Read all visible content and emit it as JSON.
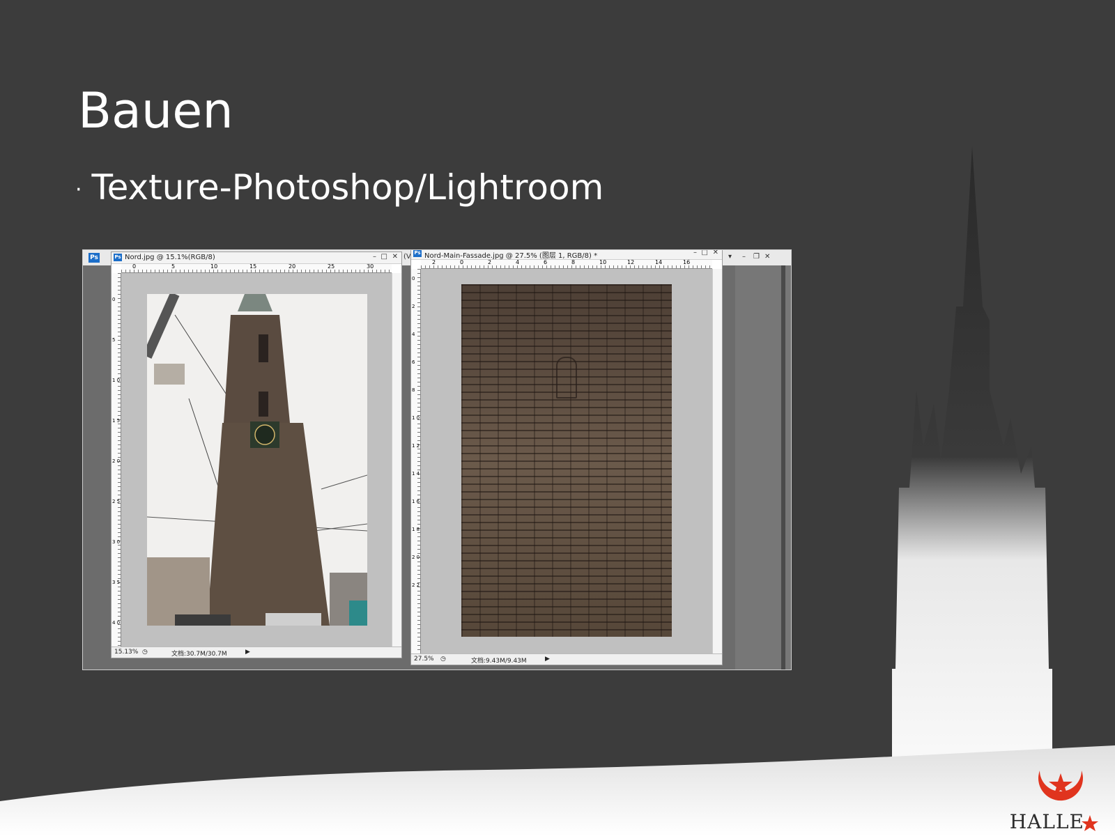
{
  "slide": {
    "title": "Bauen",
    "bullet": "Texture-Photoshop/Lightroom"
  },
  "app": {
    "icon_label": "Ps",
    "left_doc": {
      "icon_label": "Ps",
      "title": "Nord.jpg @ 15.1%(RGB/8)",
      "zoom": "15.13%",
      "doc_size": "文档:30.7M/30.7M",
      "ruler_h_ticks": [
        "0",
        "5",
        "10",
        "15",
        "20",
        "25",
        "30"
      ],
      "ruler_v_ticks": [
        "0",
        "5",
        "1 0",
        "1 5",
        "2 0",
        "2 5",
        "3 0",
        "3 5",
        "4 0"
      ]
    },
    "right_doc": {
      "icon_label": "Ps",
      "title": "Nord-Main-Fassade.jpg @ 27.5% (图层 1, RGB/8) *",
      "zoom": "27.5%",
      "doc_size": "文档:9.43M/9.43M",
      "ruler_h_ticks": [
        "2",
        "0",
        "2",
        "4",
        "6",
        "8",
        "10",
        "12",
        "14",
        "16"
      ],
      "ruler_v_ticks": [
        "0",
        "2",
        "4",
        "6",
        "8",
        "1 0",
        "1 2",
        "1 4",
        "1 6",
        "1 8",
        "2 0",
        "2 2"
      ]
    },
    "partial_title": "(V"
  },
  "logo": {
    "text": "HALLE"
  },
  "colors": {
    "background": "#3c3c3c",
    "logo_red": "#e0341e"
  }
}
